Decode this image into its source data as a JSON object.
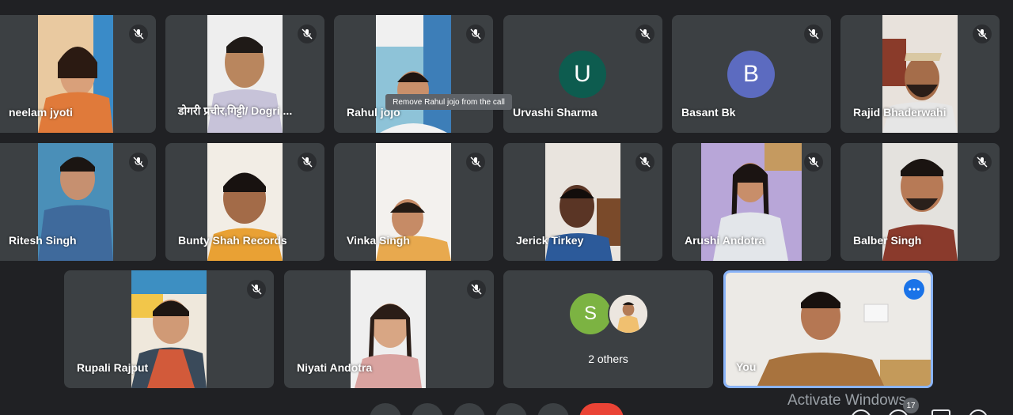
{
  "participants": [
    {
      "name": "neelam jyoti"
    },
    {
      "name": "डोगरी प्रचीर,गिट्टी/ Dogri ..."
    },
    {
      "name": "Rahul jojo"
    },
    {
      "name": "Urvashi Sharma",
      "initial": "U",
      "color": "#0d5c4f"
    },
    {
      "name": "Basant Bk",
      "initial": "B",
      "color": "#5c6bc0"
    },
    {
      "name": "Rajid Bhaderwahi"
    },
    {
      "name": "Ritesh Singh"
    },
    {
      "name": "Bunty Shah Records"
    },
    {
      "name": "Vinka Singh"
    },
    {
      "name": "Jerick Tirkey"
    },
    {
      "name": "Arushi Andotra"
    },
    {
      "name": "Balber Singh"
    },
    {
      "name": "Rupali Rajput"
    },
    {
      "name": "Niyati Andotra"
    }
  ],
  "others": {
    "label": "2 others",
    "initial": "S",
    "color": "#7cb342"
  },
  "self": {
    "name": "You"
  },
  "tooltip": "Remove Rahul jojo from the call",
  "watermark": "Activate Windows",
  "people_count": "17",
  "icons": {
    "mute": "mic-off-icon",
    "more": "more-options-icon"
  }
}
